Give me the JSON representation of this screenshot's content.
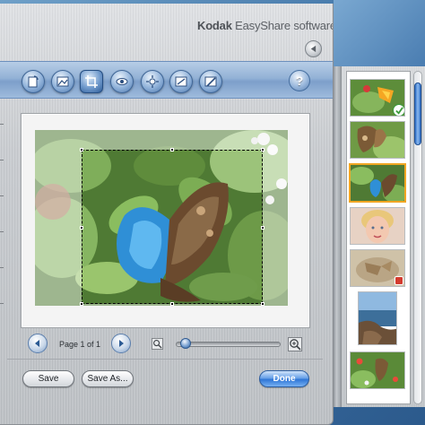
{
  "window": {
    "brand_bold": "Kodak",
    "brand_rest": " EasyShare software"
  },
  "toolbar": {
    "icons": [
      "rotate-icon",
      "red-eye-icon",
      "crop-icon",
      "eye-icon",
      "enhance-icon",
      "color-effects-icon",
      "edit-icon"
    ],
    "active_index": 2,
    "help_label": "?"
  },
  "editor": {
    "page_label": "Page 1 of 1",
    "zoom_level": 0.05
  },
  "buttons": {
    "save": "Save",
    "save_as": "Save As...",
    "done": "Done"
  },
  "colors": {
    "accent": "#2f76d6",
    "selection": "#f0a623",
    "check": "#3a9a3a"
  },
  "thumbnails": [
    {
      "name": "thumb-butterfly-orange-flower",
      "badge": "check"
    },
    {
      "name": "thumb-butterfly-leaf",
      "badge": ""
    },
    {
      "name": "thumb-butterfly-blue",
      "badge": "",
      "selected": true
    },
    {
      "name": "thumb-child-portrait",
      "badge": ""
    },
    {
      "name": "thumb-sepia-photo",
      "badge": "red"
    },
    {
      "name": "thumb-beach-rocks",
      "badge": ""
    },
    {
      "name": "thumb-butterfly-flowers",
      "badge": ""
    }
  ]
}
